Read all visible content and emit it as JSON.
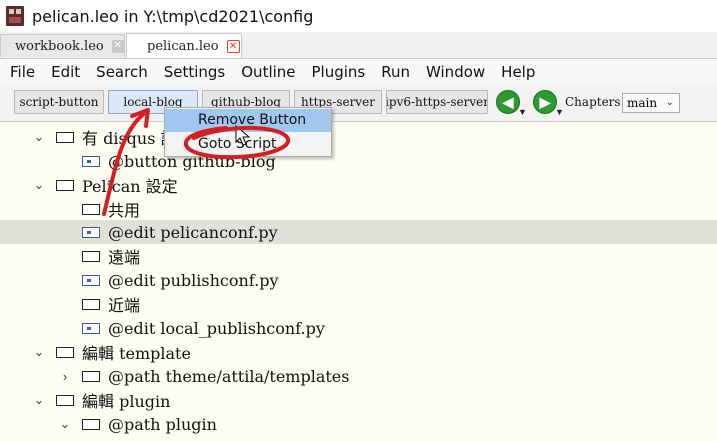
{
  "window": {
    "title": "pelican.leo in Y:\\tmp\\cd2021\\config"
  },
  "tabs": [
    {
      "label": "workbook.leo",
      "close": "✕"
    },
    {
      "label": "pelican.leo",
      "close": "✕"
    }
  ],
  "menu": [
    "File",
    "Edit",
    "Search",
    "Settings",
    "Outline",
    "Plugins",
    "Run",
    "Window",
    "Help"
  ],
  "toolbar": {
    "buttons": [
      "script-button",
      "local-blog",
      "github-blog",
      "https-server",
      "ipv6-https-server"
    ],
    "back_arrow": "◀",
    "forward_arrow": "▶",
    "arrow_caret": "▼",
    "chapters_label": "Chapters:",
    "chapters_value": "main",
    "chapters_dropdown": "⌄"
  },
  "context_menu": {
    "items": [
      "Remove Button",
      "Goto Script"
    ]
  },
  "outline": {
    "rows": [
      {
        "arrow": "⌄",
        "text": "有 disqus 設定",
        "marked": false
      },
      {
        "arrow": "",
        "text": "@button github-blog",
        "marked": true
      },
      {
        "arrow": "⌄",
        "text": "Pelican 設定",
        "marked": false
      },
      {
        "arrow": "",
        "text": "共用",
        "marked": false
      },
      {
        "arrow": "",
        "text": "@edit pelicanconf.py",
        "marked": true
      },
      {
        "arrow": "",
        "text": "遠端",
        "marked": false
      },
      {
        "arrow": "",
        "text": "@edit publishconf.py",
        "marked": true
      },
      {
        "arrow": "",
        "text": "近端",
        "marked": false
      },
      {
        "arrow": "",
        "text": "@edit local_publishconf.py",
        "marked": true
      },
      {
        "arrow": "⌄",
        "text": "編輯 template",
        "marked": false
      },
      {
        "arrow": "›",
        "text": "@path theme/attila/templates",
        "marked": false
      },
      {
        "arrow": "⌄",
        "text": "編輯 plugin",
        "marked": false
      },
      {
        "arrow": "⌄",
        "text": "@path plugin",
        "marked": false
      }
    ]
  },
  "colors": {
    "annotation": "#d42020",
    "outline_bg": "#fdfdf2",
    "menu_hover": "#9fc7f0",
    "nav_green": "#2f9a2f"
  }
}
